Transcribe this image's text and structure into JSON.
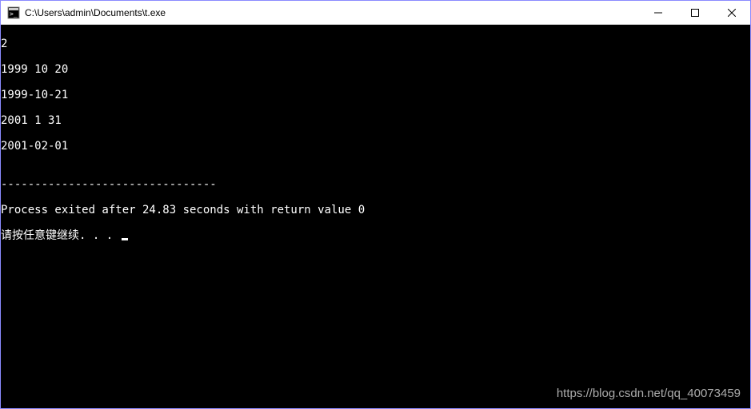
{
  "window": {
    "title": "C:\\Users\\admin\\Documents\\t.exe"
  },
  "console": {
    "lines": [
      "2",
      "1999 10 20",
      "1999-10-21",
      "2001 1 31",
      "2001-02-01",
      "",
      "--------------------------------",
      "Process exited after 24.83 seconds with return value 0"
    ],
    "prompt_line": "请按任意键继续. . . "
  },
  "watermark": "https://blog.csdn.net/qq_40073459"
}
